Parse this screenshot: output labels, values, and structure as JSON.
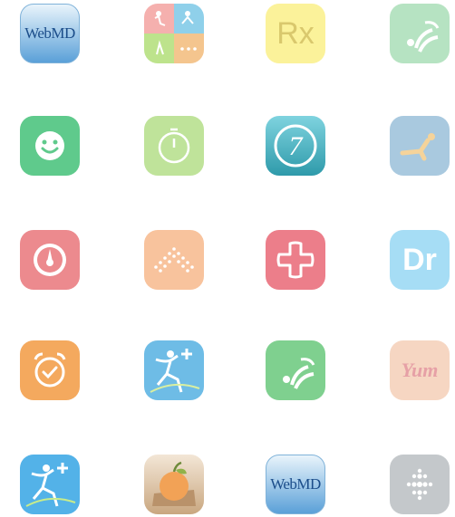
{
  "icons": [
    {
      "row": 1,
      "col": 1,
      "name": "webmd-app-icon",
      "logo": "WebMD"
    },
    {
      "row": 1,
      "col": 2,
      "name": "accessibility-grid-app-icon"
    },
    {
      "row": 1,
      "col": 3,
      "name": "rx-app-icon",
      "logo": "Rx"
    },
    {
      "row": 1,
      "col": 4,
      "name": "fitness-curves-app-icon"
    },
    {
      "row": 2,
      "col": 1,
      "name": "smiley-app-icon"
    },
    {
      "row": 2,
      "col": 2,
      "name": "timer-app-icon"
    },
    {
      "row": 2,
      "col": 3,
      "name": "seven-minute-workout-app-icon",
      "logo": "7"
    },
    {
      "row": 2,
      "col": 4,
      "name": "situp-workout-app-icon"
    },
    {
      "row": 3,
      "col": 1,
      "name": "gauge-app-icon"
    },
    {
      "row": 3,
      "col": 2,
      "name": "dots-arrow-app-icon"
    },
    {
      "row": 3,
      "col": 3,
      "name": "medical-cross-app-icon"
    },
    {
      "row": 3,
      "col": 4,
      "name": "doctor-app-icon",
      "logo": "Dr"
    },
    {
      "row": 4,
      "col": 1,
      "name": "alarm-clock-app-icon"
    },
    {
      "row": 4,
      "col": 2,
      "name": "runner-plus-app-icon"
    },
    {
      "row": 4,
      "col": 3,
      "name": "fitness-curves-app-icon-2"
    },
    {
      "row": 4,
      "col": 4,
      "name": "yum-app-icon",
      "logo": "Yum"
    },
    {
      "row": 5,
      "col": 1,
      "name": "runner-plus-app-icon-2"
    },
    {
      "row": 5,
      "col": 2,
      "name": "fruit-app-icon"
    },
    {
      "row": 5,
      "col": 3,
      "name": "webmd-app-icon-2",
      "logo": "WebMD"
    },
    {
      "row": 5,
      "col": 4,
      "name": "fitbit-app-icon"
    }
  ],
  "colors": {
    "webmd_blue": "#5aa0d8",
    "green": "#62c98c",
    "red": "#ec7a86",
    "orange": "#f4b26c",
    "teal": "#49b8c6",
    "gray": "#b8bcc0"
  }
}
